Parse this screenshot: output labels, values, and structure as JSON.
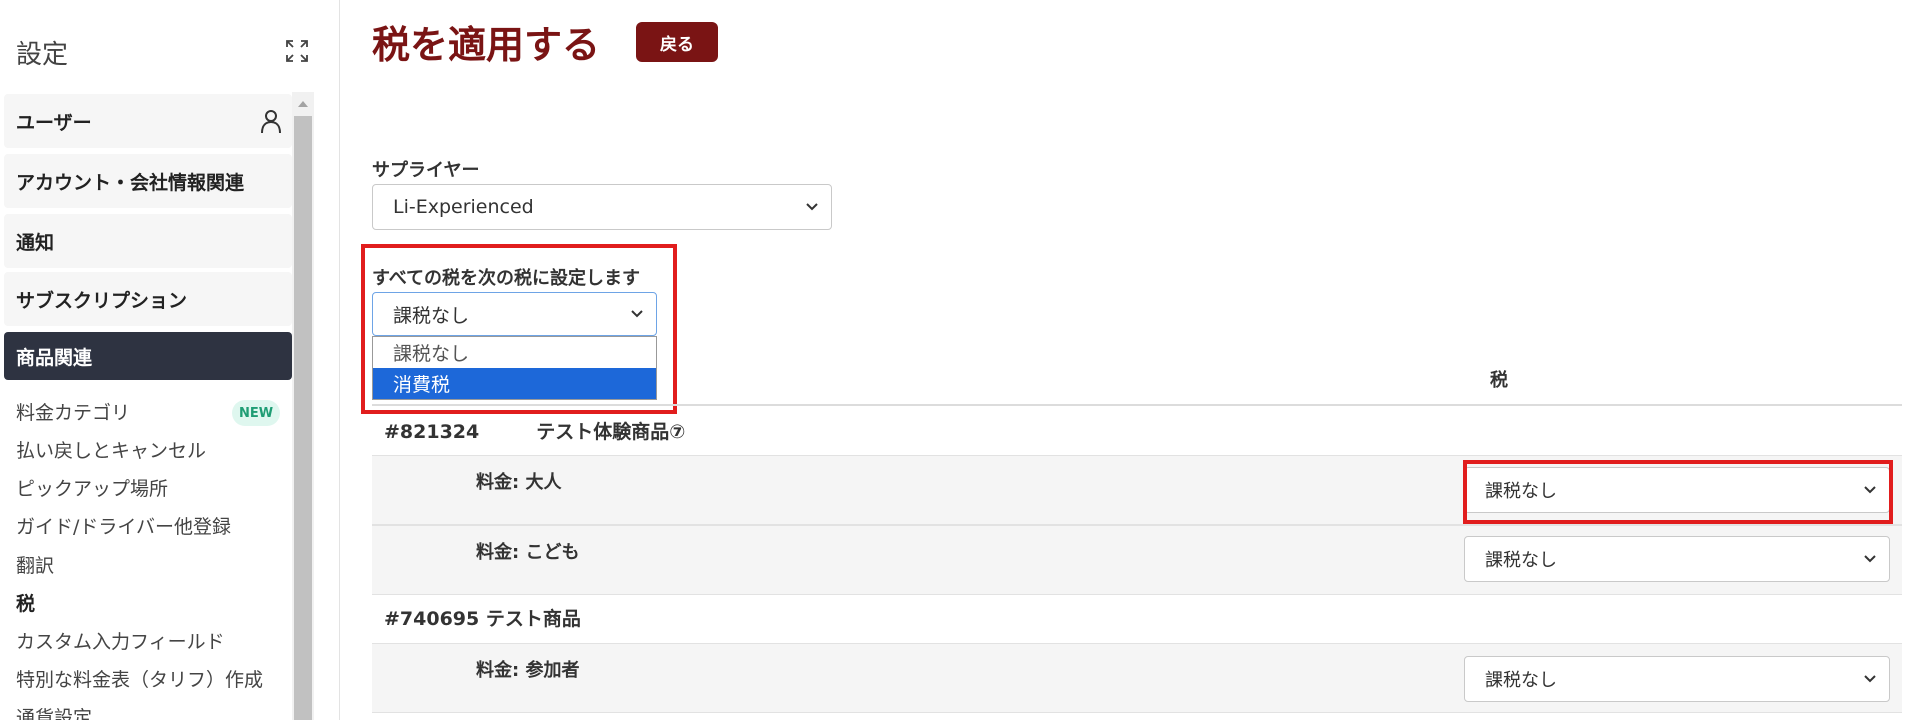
{
  "sidebar": {
    "title": "設定",
    "groups": {
      "users": "ユーザー",
      "account": "アカウント・会社情報関連",
      "notifications": "通知",
      "subscription": "サブスクリプション",
      "products": "商品関連"
    },
    "items": [
      "料金カテゴリ",
      "払い戻しとキャンセル",
      "ピックアップ場所",
      "ガイド/ドライバー他登録",
      "翻訳",
      "税",
      "カスタム入力フィールド",
      "特別な料金表（タリフ）作成",
      "通貨設定"
    ],
    "new_badge": "NEW"
  },
  "main": {
    "title": "税を適用する",
    "back_button": "戻る",
    "supplier_label": "サプライヤー",
    "supplier_value": "Li-Experienced",
    "set_all_label": "すべての税を次の税に設定します",
    "set_all_value": "課税なし",
    "dropdown_options": [
      "課税なし",
      "消費税"
    ],
    "tax_column_header": "税",
    "products": [
      {
        "header": "#821324　　　テスト体験商品⑦",
        "prices": [
          {
            "label": "料金: 大人",
            "tax": "課税なし"
          },
          {
            "label": "料金: こども",
            "tax": "課税なし"
          }
        ]
      },
      {
        "header": "#740695 テスト商品",
        "prices": [
          {
            "label": "料金: 参加者",
            "tax": "課税なし"
          }
        ]
      }
    ]
  },
  "colors": {
    "title_color": "#7a1414",
    "active_sidebar": "#2e3341",
    "highlight": "#e11d1d",
    "dropdown_selected": "#1d68d9"
  }
}
